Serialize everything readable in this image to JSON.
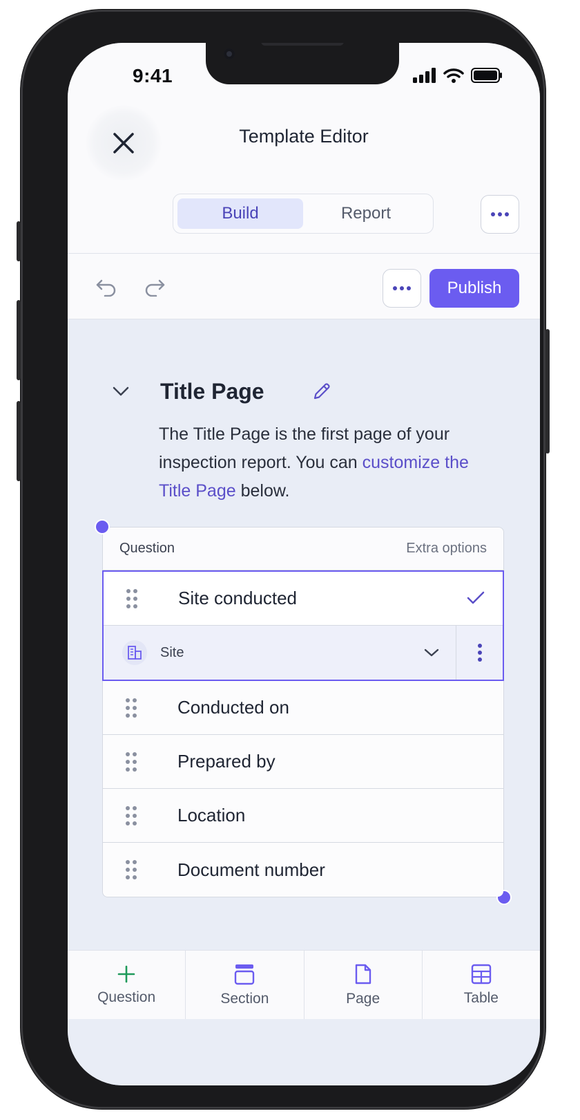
{
  "status": {
    "time": "9:41"
  },
  "header": {
    "title": "Template Editor",
    "tabs": [
      {
        "label": "Build",
        "active": true
      },
      {
        "label": "Report",
        "active": false
      }
    ]
  },
  "toolbar": {
    "publish_label": "Publish"
  },
  "section": {
    "title": "Title Page",
    "description_prefix": "The Title Page is the first page of your inspection report. You can ",
    "description_link": "customize the Title Page",
    "description_suffix": " below."
  },
  "table": {
    "header_left": "Question",
    "header_right": "Extra options",
    "selected_row": {
      "label": "Site conducted",
      "type_label": "Site"
    },
    "rows": [
      {
        "label": "Conducted on"
      },
      {
        "label": "Prepared by"
      },
      {
        "label": "Location"
      },
      {
        "label": "Document number"
      }
    ]
  },
  "bottom_bar": [
    {
      "label": "Question",
      "icon": "plus-icon"
    },
    {
      "label": "Section",
      "icon": "section-icon"
    },
    {
      "label": "Page",
      "icon": "page-icon"
    },
    {
      "label": "Table",
      "icon": "table-icon"
    }
  ],
  "colors": {
    "accent": "#6b5cf0",
    "link": "#5b4fc9",
    "active_tab_bg": "#e2e6fb",
    "plus_green": "#1f9a5a"
  }
}
